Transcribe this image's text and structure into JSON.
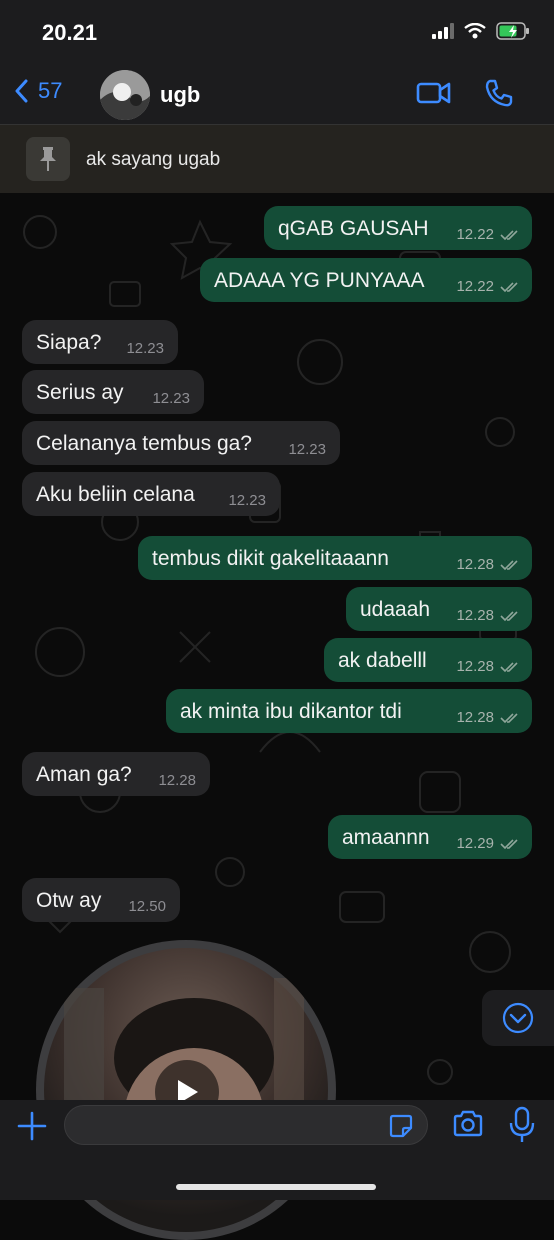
{
  "status_bar": {
    "time": "20.21"
  },
  "header": {
    "back_count": "57",
    "contact_name": "ugb"
  },
  "pinned": {
    "text": "ak sayang ugab"
  },
  "messages": [
    {
      "text": "qGAB GAUSAH",
      "time": "12.22",
      "direction": "out"
    },
    {
      "text": "ADAAA YG PUNYAAA",
      "time": "12.22",
      "direction": "out"
    },
    {
      "text": "Siapa?",
      "time": "12.23",
      "direction": "in"
    },
    {
      "text": "Serius ay",
      "time": "12.23",
      "direction": "in"
    },
    {
      "text": "Celananya tembus ga?",
      "time": "12.23",
      "direction": "in"
    },
    {
      "text": "Aku beliin celana",
      "time": "12.23",
      "direction": "in"
    },
    {
      "text": "tembus dikit gakelitaaann",
      "time": "12.28",
      "direction": "out"
    },
    {
      "text": "udaaah",
      "time": "12.28",
      "direction": "out"
    },
    {
      "text": "ak dabelll",
      "time": "12.28",
      "direction": "out"
    },
    {
      "text": "ak minta ibu dikantor tdi",
      "time": "12.28",
      "direction": "out"
    },
    {
      "text": "Aman ga?",
      "time": "12.28",
      "direction": "in"
    },
    {
      "text": "amaannn",
      "time": "12.29",
      "direction": "out"
    },
    {
      "text": "Otw ay",
      "time": "12.50",
      "direction": "in"
    }
  ],
  "colors": {
    "outgoing_bubble": "#144d37",
    "incoming_bubble": "#262628",
    "accent_blue": "#3d8bff",
    "battery_green": "#34c759"
  },
  "icons": {
    "back": "chevron-left-icon",
    "video": "video-camera-icon",
    "call": "phone-icon",
    "pin": "pin-icon",
    "add": "plus-icon",
    "sticker": "sticker-icon",
    "camera": "camera-icon",
    "mic": "microphone-icon",
    "scroll": "chevron-down-icon",
    "play": "play-icon"
  }
}
